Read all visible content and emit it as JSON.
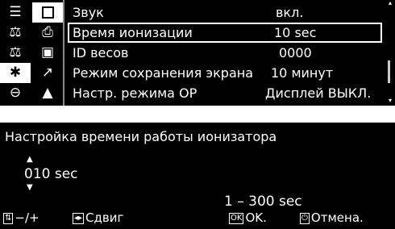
{
  "menu": {
    "icons": [
      {
        "name": "list-icon",
        "glyph": "☰"
      },
      {
        "name": "plus-box-icon",
        "glyph": "⊞"
      },
      {
        "name": "balance-icon",
        "glyph": "⚖"
      },
      {
        "name": "print-icon",
        "glyph": "⎙"
      },
      {
        "name": "balance-settings-icon",
        "glyph": "⚖"
      },
      {
        "name": "save-icon",
        "glyph": "▣"
      },
      {
        "name": "gear-icon",
        "glyph": "✱"
      },
      {
        "name": "graph-icon",
        "glyph": "↗"
      },
      {
        "name": "ion-icon",
        "glyph": "⊖"
      },
      {
        "name": "user-icon",
        "glyph": "▲"
      }
    ],
    "rows": [
      {
        "label": "Звук",
        "value": "вкл."
      },
      {
        "label": "Время ионизации",
        "value": "10 sec"
      },
      {
        "label": "ID  весов",
        "value": "0000"
      },
      {
        "label": "Режим сохранения экрана",
        "value": "10 минут"
      },
      {
        "label": "Настр. режима ОР",
        "value": "Дисплей ВЫКЛ."
      }
    ]
  },
  "editor": {
    "title": "Настройка времени работы   ионизатора",
    "value": "010 sec",
    "range": "1  –  300  sec",
    "footer": {
      "change_keys": "−/+",
      "shift_label": "Сдвиг",
      "ok_key": "OK",
      "ok_label": "OK.",
      "cancel_label": "Отмена."
    }
  }
}
